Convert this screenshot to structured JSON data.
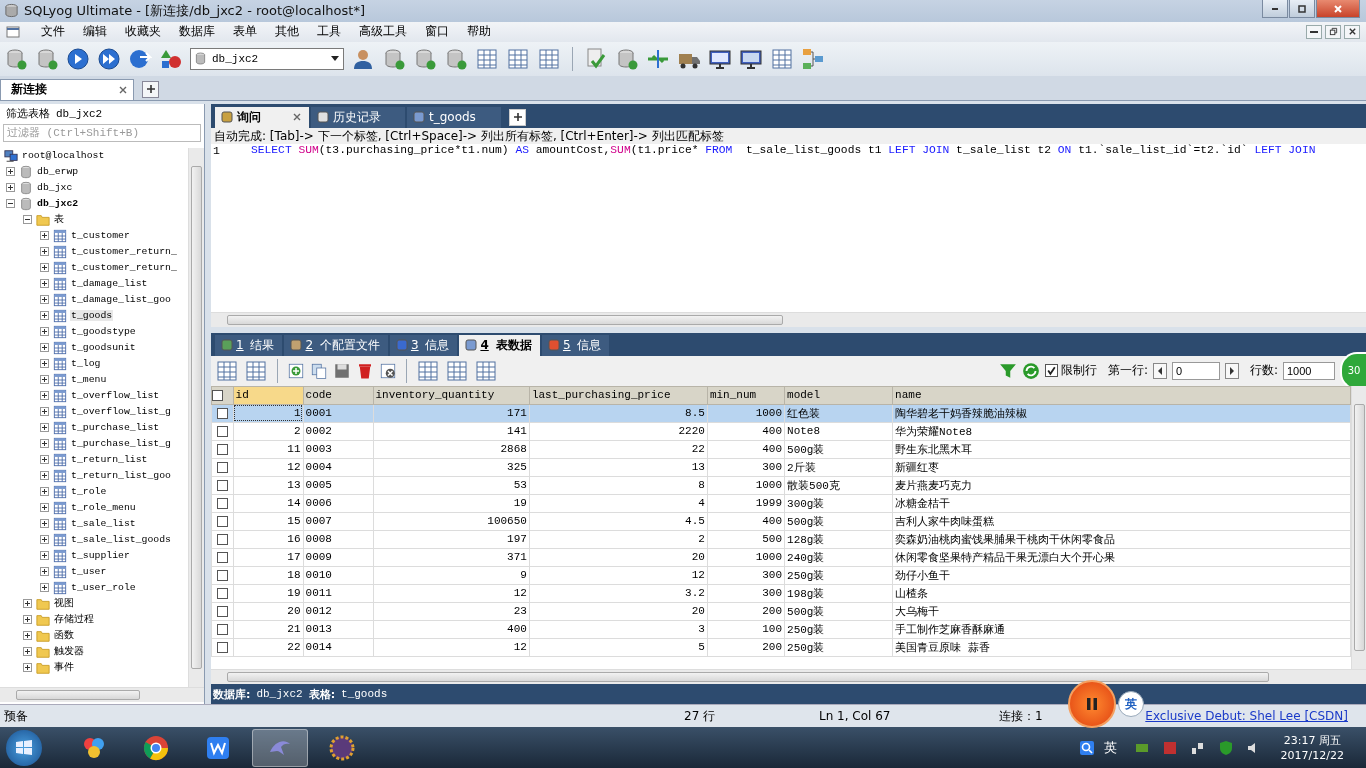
{
  "window": {
    "title": "SQLyog Ultimate - [新连接/db_jxc2 - root@localhost*]"
  },
  "menu": [
    "文件",
    "编辑",
    "收藏夹",
    "数据库",
    "表单",
    "其他",
    "工具",
    "高级工具",
    "窗口",
    "帮助"
  ],
  "toolbar": {
    "database_select": "db_jxc2"
  },
  "connection_tabs": [
    {
      "label": "新连接",
      "selected": true
    }
  ],
  "sidebar": {
    "filter_label": "筛选表格",
    "filter_database": "db_jxc2",
    "filter_placeholder": "过滤器 (Ctrl+Shift+B)",
    "tree": [
      {
        "label": "root@localhost",
        "kind": "server",
        "children": [
          {
            "label": "db_erwp",
            "kind": "database",
            "expanded": false
          },
          {
            "label": "db_jxc",
            "kind": "database",
            "expanded": false
          },
          {
            "label": "db_jxc2",
            "kind": "database",
            "expanded": true,
            "bold": true,
            "children": [
              {
                "label": "表",
                "kind": "folder",
                "expanded": true,
                "children": [
                  {
                    "label": "t_customer",
                    "kind": "table",
                    "expanded": false,
                    "selected": false
                  },
                  {
                    "label": "t_customer_return_",
                    "kind": "table",
                    "expanded": false,
                    "selected": false
                  },
                  {
                    "label": "t_customer_return_",
                    "kind": "table",
                    "expanded": false,
                    "selected": false
                  },
                  {
                    "label": "t_damage_list",
                    "kind": "table",
                    "expanded": false,
                    "selected": false
                  },
                  {
                    "label": "t_damage_list_goo",
                    "kind": "table",
                    "expanded": false,
                    "selected": false
                  },
                  {
                    "label": "t_goods",
                    "kind": "table",
                    "expanded": false,
                    "selected": true
                  },
                  {
                    "label": "t_goodstype",
                    "kind": "table",
                    "expanded": false,
                    "selected": false
                  },
                  {
                    "label": "t_goodsunit",
                    "kind": "table",
                    "expanded": false,
                    "selected": false
                  },
                  {
                    "label": "t_log",
                    "kind": "table",
                    "expanded": false,
                    "selected": false
                  },
                  {
                    "label": "t_menu",
                    "kind": "table",
                    "expanded": false,
                    "selected": false
                  },
                  {
                    "label": "t_overflow_list",
                    "kind": "table",
                    "expanded": false,
                    "selected": false
                  },
                  {
                    "label": "t_overflow_list_g",
                    "kind": "table",
                    "expanded": false,
                    "selected": false
                  },
                  {
                    "label": "t_purchase_list",
                    "kind": "table",
                    "expanded": false,
                    "selected": false
                  },
                  {
                    "label": "t_purchase_list_g",
                    "kind": "table",
                    "expanded": false,
                    "selected": false
                  },
                  {
                    "label": "t_return_list",
                    "kind": "table",
                    "expanded": false,
                    "selected": false
                  },
                  {
                    "label": "t_return_list_goo",
                    "kind": "table",
                    "expanded": false,
                    "selected": false
                  },
                  {
                    "label": "t_role",
                    "kind": "table",
                    "expanded": false,
                    "selected": false
                  },
                  {
                    "label": "t_role_menu",
                    "kind": "table",
                    "expanded": false,
                    "selected": false
                  },
                  {
                    "label": "t_sale_list",
                    "kind": "table",
                    "expanded": false,
                    "selected": false
                  },
                  {
                    "label": "t_sale_list_goods",
                    "kind": "table",
                    "expanded": false,
                    "selected": false
                  },
                  {
                    "label": "t_supplier",
                    "kind": "table",
                    "expanded": false,
                    "selected": false
                  },
                  {
                    "label": "t_user",
                    "kind": "table",
                    "expanded": false,
                    "selected": false
                  },
                  {
                    "label": "t_user_role",
                    "kind": "table",
                    "expanded": false,
                    "selected": false
                  }
                ]
              },
              {
                "label": "视图",
                "kind": "folder",
                "expanded": false
              },
              {
                "label": "存储过程",
                "kind": "folder",
                "expanded": false
              },
              {
                "label": "函数",
                "kind": "folder",
                "expanded": false
              },
              {
                "label": "触发器",
                "kind": "folder",
                "expanded": false
              },
              {
                "label": "事件",
                "kind": "folder",
                "expanded": false
              }
            ]
          }
        ]
      }
    ]
  },
  "query_tabs": [
    {
      "label": "询问",
      "kind": "query",
      "selected": true
    },
    {
      "label": "历史记录",
      "kind": "history",
      "selected": false
    },
    {
      "label": "t_goods",
      "kind": "table",
      "selected": false
    }
  ],
  "autocomplete_hint": "自动完成: [Tab]-> 下一个标签, [Ctrl+Space]-> 列出所有标签, [Ctrl+Enter]-> 列出匹配标签",
  "editor": {
    "line_number": "1",
    "tokens": [
      {
        "kind": "keyword",
        "text": "SELECT "
      },
      {
        "kind": "function",
        "text": "SUM"
      },
      {
        "kind": "plain",
        "text": "(t3.purchasing_price*t1.num) "
      },
      {
        "kind": "keyword",
        "text": "AS"
      },
      {
        "kind": "plain",
        "text": " amountCost,"
      },
      {
        "kind": "function",
        "text": "SUM"
      },
      {
        "kind": "plain",
        "text": "(t1.price* "
      },
      {
        "kind": "keyword",
        "text": "FROM"
      },
      {
        "kind": "plain",
        "text": "  t_sale_list_goods t1 "
      },
      {
        "kind": "keyword",
        "text": "LEFT JOIN"
      },
      {
        "kind": "plain",
        "text": " t_sale_list t2 "
      },
      {
        "kind": "keyword",
        "text": "ON"
      },
      {
        "kind": "plain",
        "text": " t1.`sale_list_id`=t2.`id` "
      },
      {
        "kind": "keyword",
        "text": "LEFT JOIN"
      }
    ]
  },
  "result_tabs": [
    {
      "key": "1",
      "label": "结果",
      "kind": "result",
      "selected": false
    },
    {
      "key": "2",
      "label": "个配置文件",
      "kind": "profile",
      "selected": false
    },
    {
      "key": "3",
      "label": "信息",
      "kind": "info",
      "selected": false
    },
    {
      "key": "4",
      "label": "表数据",
      "kind": "table",
      "selected": true
    },
    {
      "key": "5",
      "label": "信息",
      "kind": "messages",
      "selected": false
    }
  ],
  "results_toolbar": {
    "limit_label": "限制行",
    "limit_checked": true,
    "first_row_label": "第一行:",
    "first_row": "0",
    "rows_label": "行数:",
    "rows": "1000"
  },
  "floating_badge": "30",
  "table": {
    "select_all_checked": false,
    "columns": [
      "id",
      "code",
      "inventory_quantity",
      "last_purchasing_price",
      "min_num",
      "model",
      "name"
    ],
    "rows": [
      {
        "selected": true,
        "cells": [
          "1",
          "0001",
          "171",
          "8.5",
          "1000",
          "红色装",
          "陶华碧老干妈香辣脆油辣椒"
        ]
      },
      {
        "selected": false,
        "cells": [
          "2",
          "0002",
          "141",
          "2220",
          "400",
          "Note8",
          "华为荣耀Note8"
        ]
      },
      {
        "selected": false,
        "cells": [
          "11",
          "0003",
          "2868",
          "22",
          "400",
          "500g装",
          "野生东北黑木耳"
        ]
      },
      {
        "selected": false,
        "cells": [
          "12",
          "0004",
          "325",
          "13",
          "300",
          "2斤装",
          "新疆红枣"
        ]
      },
      {
        "selected": false,
        "cells": [
          "13",
          "0005",
          "53",
          "8",
          "1000",
          "散装500克",
          "麦片燕麦巧克力"
        ]
      },
      {
        "selected": false,
        "cells": [
          "14",
          "0006",
          "19",
          "4",
          "1999",
          "300g装",
          "冰糖金桔干"
        ]
      },
      {
        "selected": false,
        "cells": [
          "15",
          "0007",
          "100650",
          "4.5",
          "400",
          "500g装",
          "吉利人家牛肉味蛋糕"
        ]
      },
      {
        "selected": false,
        "cells": [
          "16",
          "0008",
          "197",
          "2",
          "500",
          "128g装",
          "奕森奶油桃肉蜜饯果脯果干桃肉干休闲零食品"
        ]
      },
      {
        "selected": false,
        "cells": [
          "17",
          "0009",
          "371",
          "20",
          "1000",
          "240g装",
          "休闲零食坚果特产精品干果无漂白大个开心果"
        ]
      },
      {
        "selected": false,
        "cells": [
          "18",
          "0010",
          "9",
          "12",
          "300",
          "250g装",
          "劲仔小鱼干"
        ]
      },
      {
        "selected": false,
        "cells": [
          "19",
          "0011",
          "12",
          "3.2",
          "300",
          "198g装",
          "山楂条"
        ]
      },
      {
        "selected": false,
        "cells": [
          "20",
          "0012",
          "23",
          "20",
          "200",
          "500g装",
          "大乌梅干"
        ]
      },
      {
        "selected": false,
        "cells": [
          "21",
          "0013",
          "400",
          "3",
          "100",
          "250g装",
          "手工制作芝麻香酥麻通"
        ]
      },
      {
        "selected": false,
        "cells": [
          "22",
          "0014",
          "12",
          "5",
          "200",
          "250g装",
          "美国青豆原味 蒜香"
        ]
      }
    ]
  },
  "info_bar": {
    "database_label": "数据库:",
    "database": "db_jxc2",
    "table_label": "表格:",
    "table": "t_goods"
  },
  "status_bar": {
    "state": "预备",
    "rows": "27 行",
    "position": "Ln 1, Col 67",
    "connections": "连接：1"
  },
  "recorder": {
    "ime": "英",
    "credit": "Exclusive Debut: Shel Lee [CSDN]"
  },
  "taskbar": {
    "ime": "英",
    "time": "23:17 周五",
    "date": "2017/12/22"
  }
}
